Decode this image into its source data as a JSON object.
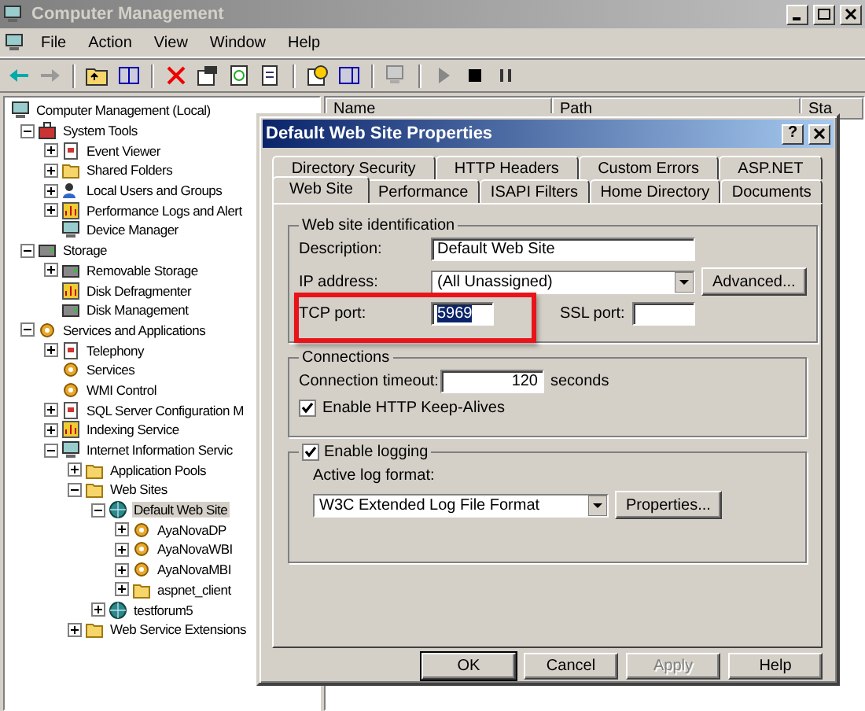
{
  "window": {
    "title": "Computer Management"
  },
  "menu": [
    "File",
    "Action",
    "View",
    "Window",
    "Help"
  ],
  "tree": {
    "label": "Computer Management (Local)",
    "kind": "computer",
    "selected": false,
    "children": [
      {
        "label": "System Tools",
        "kind": "toolbox",
        "expanded": true,
        "selected": false,
        "children": [
          {
            "label": "Event Viewer",
            "kind": "document",
            "expanded": false,
            "selected": false
          },
          {
            "label": "Shared Folders",
            "kind": "folder",
            "expanded": false,
            "selected": false
          },
          {
            "label": "Local Users and Groups",
            "kind": "users",
            "expanded": false,
            "selected": false
          },
          {
            "label": "Performance Logs and Alert",
            "kind": "chart",
            "expanded": false,
            "selected": false
          },
          {
            "label": "Device Manager",
            "kind": "computer",
            "selected": false
          }
        ]
      },
      {
        "label": "Storage",
        "kind": "disk",
        "expanded": true,
        "selected": false,
        "children": [
          {
            "label": "Removable Storage",
            "kind": "disk",
            "expanded": false,
            "selected": false
          },
          {
            "label": "Disk Defragmenter",
            "kind": "chart",
            "selected": false
          },
          {
            "label": "Disk Management",
            "kind": "disk",
            "selected": false
          }
        ]
      },
      {
        "label": "Services and Applications",
        "kind": "gear",
        "expanded": true,
        "selected": false,
        "children": [
          {
            "label": "Telephony",
            "kind": "document",
            "expanded": false,
            "selected": false
          },
          {
            "label": "Services",
            "kind": "gear",
            "selected": false
          },
          {
            "label": "WMI Control",
            "kind": "gear",
            "selected": false
          },
          {
            "label": "SQL Server Configuration M",
            "kind": "document",
            "expanded": false,
            "selected": false
          },
          {
            "label": "Indexing Service",
            "kind": "chart",
            "expanded": false,
            "selected": false
          },
          {
            "label": "Internet Information Servic",
            "kind": "computer",
            "expanded": true,
            "selected": false,
            "children": [
              {
                "label": "Application Pools",
                "kind": "folder",
                "expanded": false,
                "selected": false
              },
              {
                "label": "Web Sites",
                "kind": "folder",
                "expanded": true,
                "selected": false,
                "children": [
                  {
                    "label": "Default Web Site",
                    "kind": "globe",
                    "expanded": true,
                    "selected": true,
                    "children": [
                      {
                        "label": "AyaNovaDP",
                        "kind": "gear",
                        "expanded": false,
                        "selected": false
                      },
                      {
                        "label": "AyaNovaWBI",
                        "kind": "gear",
                        "expanded": false,
                        "selected": false
                      },
                      {
                        "label": "AyaNovaMBI",
                        "kind": "gear",
                        "expanded": false,
                        "selected": false
                      },
                      {
                        "label": "aspnet_client",
                        "kind": "folder",
                        "expanded": false,
                        "selected": false
                      }
                    ]
                  },
                  {
                    "label": "testforum5",
                    "kind": "globe",
                    "expanded": false,
                    "selected": false
                  }
                ]
              },
              {
                "label": "Web Service Extensions",
                "kind": "folder",
                "expanded": false,
                "selected": false
              }
            ]
          }
        ]
      }
    ]
  },
  "list": {
    "columns": [
      "Name",
      "Path",
      "Sta"
    ]
  },
  "dialog": {
    "title": "Default Web Site Properties",
    "help_button": "?",
    "tab_rows": [
      [
        {
          "label": "Directory Security",
          "selected": false
        },
        {
          "label": "HTTP Headers",
          "selected": false
        },
        {
          "label": "Custom Errors",
          "selected": false
        },
        {
          "label": "ASP.NET",
          "selected": false
        }
      ],
      [
        {
          "label": "Web Site",
          "selected": true
        },
        {
          "label": "Performance",
          "selected": false
        },
        {
          "label": "ISAPI Filters",
          "selected": false
        },
        {
          "label": "Home Directory",
          "selected": false
        },
        {
          "label": "Documents",
          "selected": false
        }
      ]
    ],
    "identification": {
      "legend": "Web site identification",
      "description_label": "Description:",
      "description": "Default Web Site",
      "ip_label": "IP address:",
      "ip": "(All Unassigned)",
      "advanced_button": "Advanced...",
      "tcp_label": "TCP port:",
      "tcp": "5969",
      "tcp_text_selected": true,
      "ssl_label": "SSL port:",
      "highlighted": true
    },
    "connections": {
      "legend": "Connections",
      "timeout_label": "Connection timeout:",
      "timeout": "120",
      "timeout_unit": "seconds",
      "keepalive": {
        "label": "Enable HTTP Keep-Alives",
        "checked": true
      }
    },
    "logging": {
      "enable": {
        "label": "Enable logging",
        "checked": true
      },
      "format_label": "Active log format:",
      "format": "W3C Extended Log File Format",
      "properties_button": "Properties..."
    },
    "buttons": [
      {
        "label": "OK",
        "default": true,
        "disabled": false
      },
      {
        "label": "Cancel",
        "default": false,
        "disabled": false
      },
      {
        "label": "Apply",
        "default": false,
        "disabled": true
      },
      {
        "label": "Help",
        "default": false,
        "disabled": false
      }
    ]
  }
}
